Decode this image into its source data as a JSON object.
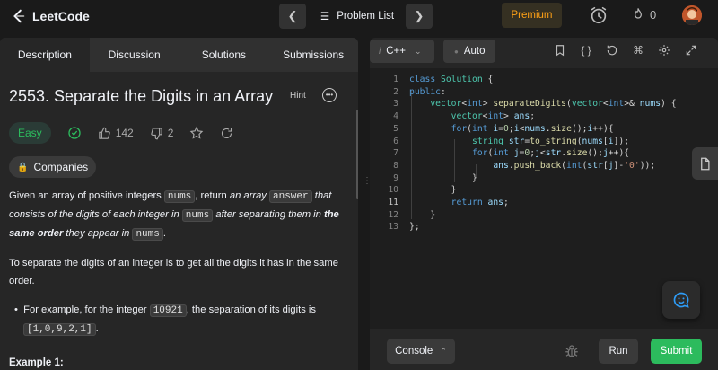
{
  "header": {
    "logo_text": "LeetCode",
    "problem_list_label": "Problem List",
    "premium_label": "Premium",
    "streak_count": "0",
    "colors": {
      "premium": "#ffa116",
      "accent_green": "#2cbb5d"
    }
  },
  "left_tabs": [
    "Description",
    "Discussion",
    "Solutions",
    "Submissions"
  ],
  "problem": {
    "title": "2553. Separate the Digits in an Array",
    "hint_label": "Hint",
    "difficulty": "Easy",
    "likes": "142",
    "dislikes": "2",
    "companies_label": "Companies",
    "desc1": {
      "a": "Given an array of positive integers ",
      "code1": "nums",
      "b": ", return ",
      "c": "an array ",
      "code2": "answer",
      "d": " that consists of the digits of each integer in ",
      "code3": "nums",
      "e": " after separating them in ",
      "f": "the same order",
      "g": " they appear in ",
      "code4": "nums",
      "h": "."
    },
    "desc2": "To separate the digits of an integer is to get all the digits it has in the same order.",
    "bullet": {
      "a": "For example, for the integer ",
      "code1": "10921",
      "b": ", the separation of its digits is ",
      "code2": "[1,0,9,2,1]",
      "c": "."
    },
    "example_heading": "Example 1:"
  },
  "editor": {
    "language": "C++",
    "mode": "Auto",
    "current_line": 11,
    "line_numbers": [
      "1",
      "2",
      "3",
      "4",
      "5",
      "6",
      "7",
      "8",
      "9",
      "10",
      "11",
      "12",
      "13"
    ]
  },
  "bottom": {
    "console_label": "Console",
    "run_label": "Run",
    "submit_label": "Submit"
  }
}
